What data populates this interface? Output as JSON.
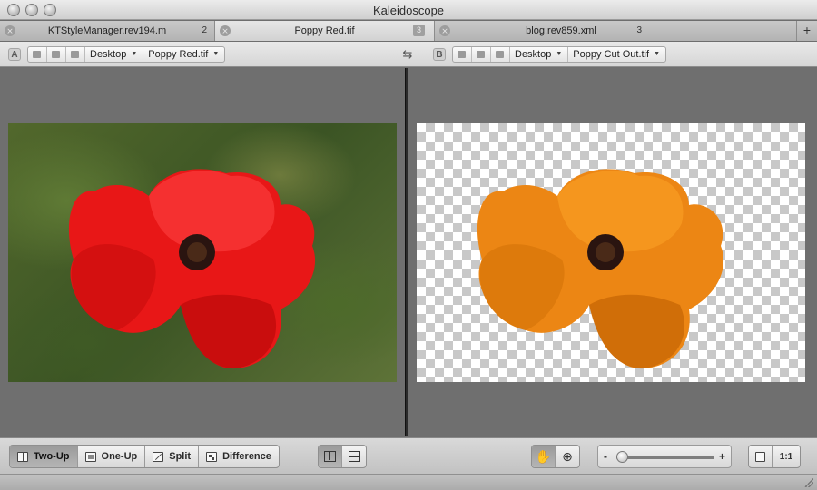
{
  "window": {
    "title": "Kaleidoscope"
  },
  "tabs": [
    {
      "label": "KTStyleManager.rev194.m",
      "count": "2",
      "active": false
    },
    {
      "label": "Poppy Red.tif",
      "count": "3",
      "active": true
    },
    {
      "label": "blog.rev859.xml",
      "count": "3",
      "active": false
    }
  ],
  "tab_add_label": "+",
  "tab_close_glyph": "⨯",
  "side_a": {
    "letter": "A",
    "crumbs": [
      "Desktop",
      "Poppy Red.tif"
    ]
  },
  "side_b": {
    "letter": "B",
    "crumbs": [
      "Desktop",
      "Poppy Cut Out.tif"
    ]
  },
  "swap_glyph": "⇆",
  "dropdown_glyph": "▼",
  "modes": [
    {
      "label": "Two-Up",
      "icon": "two-up-icon",
      "active": true
    },
    {
      "label": "One-Up",
      "icon": "one-up-icon",
      "active": false
    },
    {
      "label": "Split",
      "icon": "split-icon",
      "active": false
    },
    {
      "label": "Difference",
      "icon": "difference-icon",
      "active": false
    }
  ],
  "layout": {
    "active": "vertical"
  },
  "tools": {
    "active": "hand",
    "hand_glyph": "✋",
    "zoom_glyph": "⊕"
  },
  "zoom": {
    "minus": "-",
    "plus": "+",
    "level": 0.05
  },
  "actual_size_label": "1:1",
  "colors": {
    "poppy_red": "#ee1c1c",
    "poppy_orange": "#f08a16",
    "pane_bg": "#6f6f6f"
  }
}
